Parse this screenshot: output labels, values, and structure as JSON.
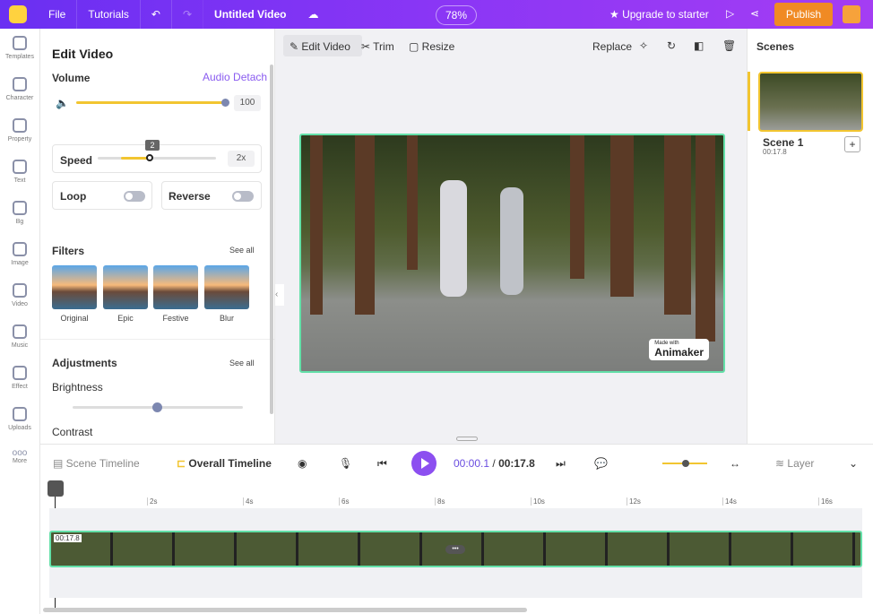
{
  "topbar": {
    "file": "File",
    "tutorials": "Tutorials",
    "title": "Untitled Video",
    "zoom": "78%",
    "upgrade": "★ Upgrade to starter",
    "publish": "Publish"
  },
  "rail": [
    "Templates",
    "Character",
    "Property",
    "Text",
    "Bg",
    "Image",
    "Video",
    "Music",
    "Effect",
    "Uploads",
    "More"
  ],
  "panel": {
    "title": "Edit Video",
    "volume": "Volume",
    "audio_detach": "Audio Detach",
    "volume_value": "100",
    "speed": "Speed",
    "speed_tip": "2",
    "speed_value": "2x",
    "loop": "Loop",
    "reverse": "Reverse",
    "filters": "Filters",
    "see_all": "See all",
    "filter_names": [
      "Original",
      "Epic",
      "Festive",
      "Blur"
    ],
    "adjustments": "Adjustments",
    "see_all2": "See all",
    "brightness": "Brightness",
    "contrast": "Contrast"
  },
  "toolbar": {
    "edit_video": "Edit Video",
    "trim": "Trim",
    "resize": "Resize",
    "replace": "Replace"
  },
  "video": {
    "watermark": "Animaker",
    "watermark_small": "Made with"
  },
  "scenes": {
    "title": "Scenes",
    "scene_name": "Scene 1",
    "scene_duration": "00:17.8"
  },
  "timeline": {
    "scene_timeline": "Scene Timeline",
    "overall_timeline": "Overall Timeline",
    "current": "00:00.1",
    "sep": " / ",
    "total": "00:17.8",
    "layer": "Layer",
    "ticks": [
      "2s",
      "4s",
      "6s",
      "8s",
      "10s",
      "12s",
      "14s",
      "16s"
    ],
    "clip_label": "00:17.8"
  },
  "colors": {
    "accent": "#8c4ff0",
    "publish": "#f08a24",
    "slider": "#f2c530",
    "selection": "#63e0a8"
  }
}
